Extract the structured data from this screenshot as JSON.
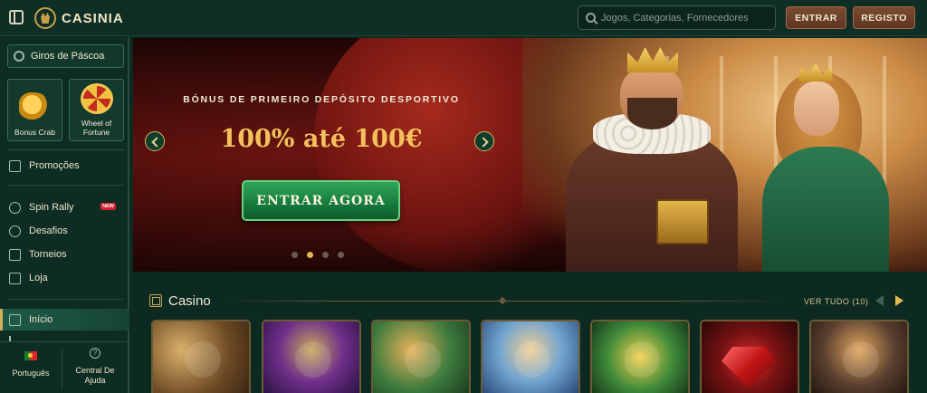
{
  "header": {
    "logo_text": "CASINIA",
    "search_placeholder": "Jogos, Categorias, Fornecedores",
    "login_label": "ENTRAR",
    "register_label": "REGISTO"
  },
  "sidebar": {
    "promo_pill": "Giros de Páscoa",
    "tiles": [
      {
        "label": "Bonus Crab"
      },
      {
        "label": "Wheel of Fortune"
      }
    ],
    "items": [
      {
        "label": "Promoções",
        "icon": "promotions-icon"
      },
      {
        "label": "Spin Rally",
        "icon": "spin-rally-icon",
        "badge": "NEW"
      },
      {
        "label": "Desafios",
        "icon": "challenges-icon"
      },
      {
        "label": "Torneios",
        "icon": "trophy-icon"
      },
      {
        "label": "Loja",
        "icon": "shop-icon"
      },
      {
        "label": "Início",
        "icon": "home-icon",
        "active": true
      }
    ],
    "language": "Português",
    "help": "Central De Ajuda"
  },
  "hero": {
    "subtitle": "BÓNUS DE PRIMEIRO DEPÓSITO DESPORTIVO",
    "title": "100% até 100€",
    "cta": "ENTRAR AGORA",
    "slides_total": 4,
    "active_slide": 2
  },
  "casino": {
    "title": "Casino",
    "see_all": "VER TUDO (10)"
  },
  "colors": {
    "background": "#0c2a22",
    "accent_gold": "#e4b84d",
    "cta_green": "#167a3c",
    "button_brown": "#6b402a"
  }
}
